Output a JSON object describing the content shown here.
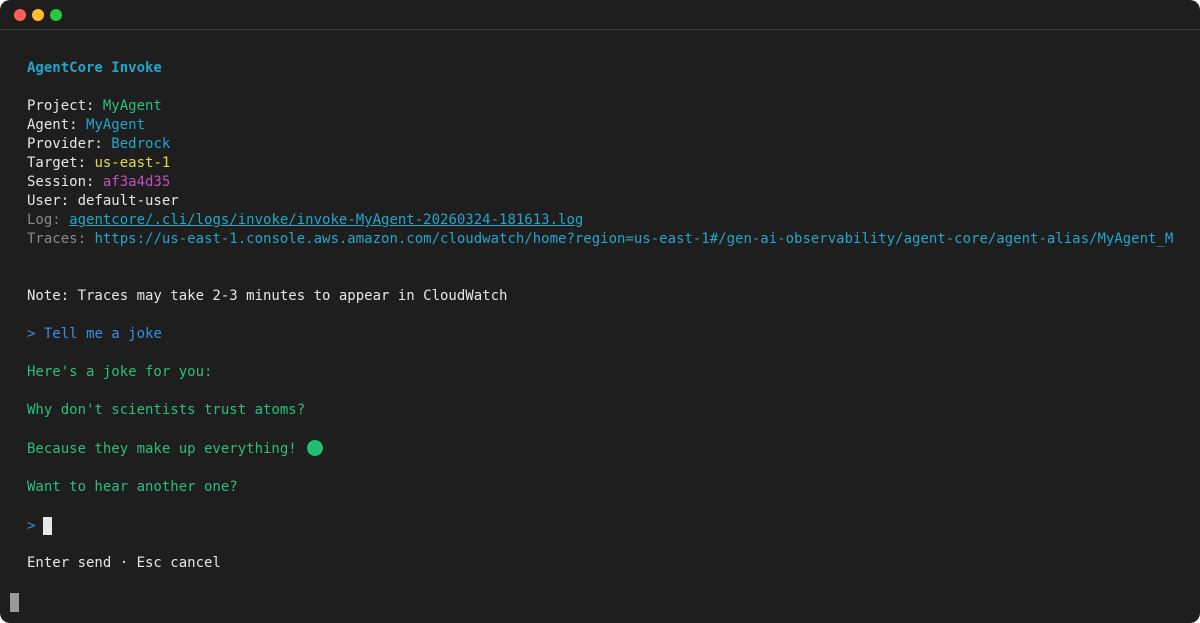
{
  "window": {
    "controls": {
      "close_color": "#ff5f57",
      "minimize_color": "#febc2e",
      "zoom_color": "#28c840"
    }
  },
  "colors": {
    "cyan": "#22a6c9",
    "green": "#2bbd7e",
    "yellow": "#e5d94a",
    "magenta": "#c74fc0",
    "blue": "#3b8fe0",
    "emoji_green": "#1fc06f"
  },
  "header": {
    "title": "AgentCore Invoke"
  },
  "info": {
    "project_label": "Project: ",
    "project_value": "MyAgent",
    "agent_label": "Agent: ",
    "agent_value": "MyAgent",
    "provider_label": "Provider: ",
    "provider_value": "Bedrock",
    "target_label": "Target: ",
    "target_value": "us-east-1",
    "session_label": "Session: ",
    "session_value": "af3a4d35",
    "user_label": "User: ",
    "user_value": "default-user",
    "log_label": "Log: ",
    "log_value": "agentcore/.cli/logs/invoke/invoke-MyAgent-20260324-181613.log",
    "traces_label": "Traces: ",
    "traces_value": "https://us-east-1.console.aws.amazon.com/cloudwatch/home?region=us-east-1#/gen-ai-observability/agent-core/agent-alias/MyAgent_M"
  },
  "note": "Note: Traces may take 2-3 minutes to appear in CloudWatch",
  "conversation": {
    "prompt_symbol": ">",
    "user_message": "Tell me a joke",
    "response_lines": [
      "Here's a joke for you:",
      "Why don't scientists trust atoms?",
      "Because they make up everything!",
      "Want to hear another one?"
    ]
  },
  "footer": {
    "hint": "Enter send · Esc cancel"
  }
}
